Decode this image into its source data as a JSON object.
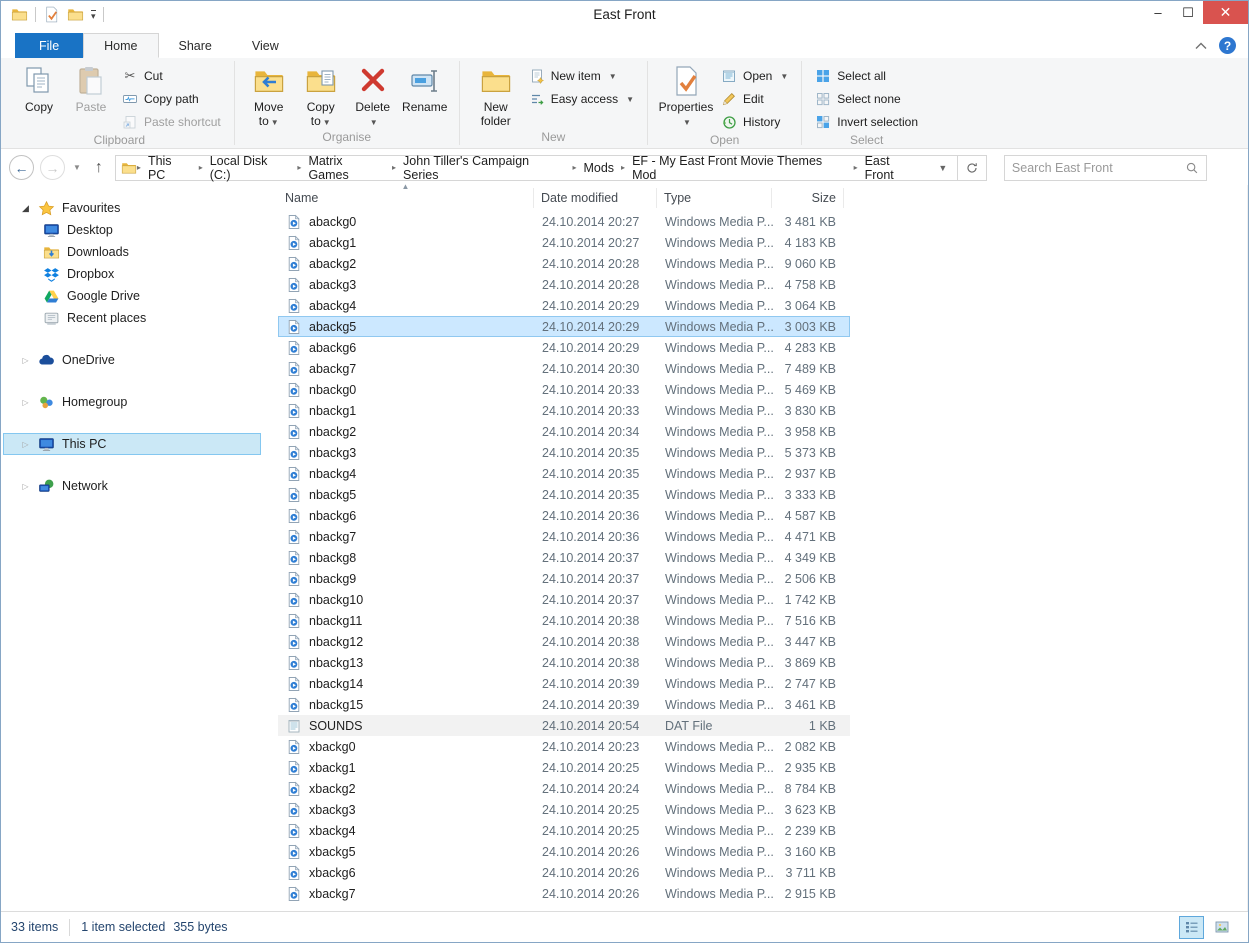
{
  "window": {
    "title": "East Front"
  },
  "colors": {
    "accent_blue": "#1973c5",
    "selection_bg": "#cce8ff",
    "selection_border": "#90c8f0",
    "sidebar_selection_bg": "#cbe8f6",
    "close_button_red": "#d9534f",
    "status_text": "#24456e",
    "ribbon_bg": "#f5f6f7"
  },
  "tabs": {
    "file": "File",
    "home": "Home",
    "share": "Share",
    "view": "View",
    "active": "Home"
  },
  "ribbon": {
    "clipboard": {
      "label": "Clipboard",
      "copy": "Copy",
      "paste": "Paste",
      "cut": "Cut",
      "copy_path": "Copy path",
      "paste_shortcut": "Paste shortcut"
    },
    "organise": {
      "label": "Organise",
      "move_to": "Move to",
      "copy_to": "Copy to",
      "delete": "Delete",
      "rename": "Rename"
    },
    "new": {
      "label": "New",
      "new_folder": "New folder",
      "new_item": "New item",
      "easy_access": "Easy access"
    },
    "open": {
      "label": "Open",
      "properties": "Properties",
      "open": "Open",
      "edit": "Edit",
      "history": "History"
    },
    "select": {
      "label": "Select",
      "select_all": "Select all",
      "select_none": "Select none",
      "invert_selection": "Invert selection"
    }
  },
  "address": {
    "crumbs": [
      "This PC",
      "Local Disk (C:)",
      "Matrix Games",
      "John Tiller's Campaign Series",
      "Mods",
      "EF - My East Front Movie Themes Mod",
      "East Front"
    ],
    "search_placeholder": "Search East Front"
  },
  "sidebar": {
    "sections": [
      {
        "label": "Favourites",
        "icon": "i-star",
        "expanded": true,
        "children": [
          {
            "label": "Desktop",
            "icon": "i-monitor"
          },
          {
            "label": "Downloads",
            "icon": "i-downloads"
          },
          {
            "label": "Dropbox",
            "icon": "i-dropbox"
          },
          {
            "label": "Google Drive",
            "icon": "i-gdrive"
          },
          {
            "label": "Recent places",
            "icon": "i-recent"
          }
        ]
      },
      {
        "label": "OneDrive",
        "icon": "i-cloud",
        "expanded": false,
        "children": []
      },
      {
        "label": "Homegroup",
        "icon": "i-homegroup",
        "expanded": false,
        "children": []
      },
      {
        "label": "This PC",
        "icon": "i-monitor",
        "expanded": false,
        "selected": true,
        "children": []
      },
      {
        "label": "Network",
        "icon": "i-network",
        "expanded": false,
        "children": []
      }
    ]
  },
  "list": {
    "columns": {
      "name": "Name",
      "date": "Date modified",
      "type": "Type",
      "size": "Size"
    },
    "sort_column": "Name",
    "rows": [
      {
        "name": "abackg0",
        "date": "24.10.2014 20:27",
        "type": "Windows Media P...",
        "size": "3 481 KB",
        "icon": "i-wmp"
      },
      {
        "name": "abackg1",
        "date": "24.10.2014 20:27",
        "type": "Windows Media P...",
        "size": "4 183 KB",
        "icon": "i-wmp"
      },
      {
        "name": "abackg2",
        "date": "24.10.2014 20:28",
        "type": "Windows Media P...",
        "size": "9 060 KB",
        "icon": "i-wmp"
      },
      {
        "name": "abackg3",
        "date": "24.10.2014 20:28",
        "type": "Windows Media P...",
        "size": "4 758 KB",
        "icon": "i-wmp"
      },
      {
        "name": "abackg4",
        "date": "24.10.2014 20:29",
        "type": "Windows Media P...",
        "size": "3 064 KB",
        "icon": "i-wmp"
      },
      {
        "name": "abackg5",
        "date": "24.10.2014 20:29",
        "type": "Windows Media P...",
        "size": "3 003 KB",
        "icon": "i-wmp",
        "selected": true
      },
      {
        "name": "abackg6",
        "date": "24.10.2014 20:29",
        "type": "Windows Media P...",
        "size": "4 283 KB",
        "icon": "i-wmp"
      },
      {
        "name": "abackg7",
        "date": "24.10.2014 20:30",
        "type": "Windows Media P...",
        "size": "7 489 KB",
        "icon": "i-wmp"
      },
      {
        "name": "nbackg0",
        "date": "24.10.2014 20:33",
        "type": "Windows Media P...",
        "size": "5 469 KB",
        "icon": "i-wmp"
      },
      {
        "name": "nbackg1",
        "date": "24.10.2014 20:33",
        "type": "Windows Media P...",
        "size": "3 830 KB",
        "icon": "i-wmp"
      },
      {
        "name": "nbackg2",
        "date": "24.10.2014 20:34",
        "type": "Windows Media P...",
        "size": "3 958 KB",
        "icon": "i-wmp"
      },
      {
        "name": "nbackg3",
        "date": "24.10.2014 20:35",
        "type": "Windows Media P...",
        "size": "5 373 KB",
        "icon": "i-wmp"
      },
      {
        "name": "nbackg4",
        "date": "24.10.2014 20:35",
        "type": "Windows Media P...",
        "size": "2 937 KB",
        "icon": "i-wmp"
      },
      {
        "name": "nbackg5",
        "date": "24.10.2014 20:35",
        "type": "Windows Media P...",
        "size": "3 333 KB",
        "icon": "i-wmp"
      },
      {
        "name": "nbackg6",
        "date": "24.10.2014 20:36",
        "type": "Windows Media P...",
        "size": "4 587 KB",
        "icon": "i-wmp"
      },
      {
        "name": "nbackg7",
        "date": "24.10.2014 20:36",
        "type": "Windows Media P...",
        "size": "4 471 KB",
        "icon": "i-wmp"
      },
      {
        "name": "nbackg8",
        "date": "24.10.2014 20:37",
        "type": "Windows Media P...",
        "size": "4 349 KB",
        "icon": "i-wmp"
      },
      {
        "name": "nbackg9",
        "date": "24.10.2014 20:37",
        "type": "Windows Media P...",
        "size": "2 506 KB",
        "icon": "i-wmp"
      },
      {
        "name": "nbackg10",
        "date": "24.10.2014 20:37",
        "type": "Windows Media P...",
        "size": "1 742 KB",
        "icon": "i-wmp"
      },
      {
        "name": "nbackg11",
        "date": "24.10.2014 20:38",
        "type": "Windows Media P...",
        "size": "7 516 KB",
        "icon": "i-wmp"
      },
      {
        "name": "nbackg12",
        "date": "24.10.2014 20:38",
        "type": "Windows Media P...",
        "size": "3 447 KB",
        "icon": "i-wmp"
      },
      {
        "name": "nbackg13",
        "date": "24.10.2014 20:38",
        "type": "Windows Media P...",
        "size": "3 869 KB",
        "icon": "i-wmp"
      },
      {
        "name": "nbackg14",
        "date": "24.10.2014 20:39",
        "type": "Windows Media P...",
        "size": "2 747 KB",
        "icon": "i-wmp"
      },
      {
        "name": "nbackg15",
        "date": "24.10.2014 20:39",
        "type": "Windows Media P...",
        "size": "3 461 KB",
        "icon": "i-wmp"
      },
      {
        "name": "SOUNDS",
        "date": "24.10.2014 20:54",
        "type": "DAT File",
        "size": "1 KB",
        "icon": "i-dat",
        "hover": true
      },
      {
        "name": "xbackg0",
        "date": "24.10.2014 20:23",
        "type": "Windows Media P...",
        "size": "2 082 KB",
        "icon": "i-wmp"
      },
      {
        "name": "xbackg1",
        "date": "24.10.2014 20:25",
        "type": "Windows Media P...",
        "size": "2 935 KB",
        "icon": "i-wmp"
      },
      {
        "name": "xbackg2",
        "date": "24.10.2014 20:24",
        "type": "Windows Media P...",
        "size": "8 784 KB",
        "icon": "i-wmp"
      },
      {
        "name": "xbackg3",
        "date": "24.10.2014 20:25",
        "type": "Windows Media P...",
        "size": "3 623 KB",
        "icon": "i-wmp"
      },
      {
        "name": "xbackg4",
        "date": "24.10.2014 20:25",
        "type": "Windows Media P...",
        "size": "2 239 KB",
        "icon": "i-wmp"
      },
      {
        "name": "xbackg5",
        "date": "24.10.2014 20:26",
        "type": "Windows Media P...",
        "size": "3 160 KB",
        "icon": "i-wmp"
      },
      {
        "name": "xbackg6",
        "date": "24.10.2014 20:26",
        "type": "Windows Media P...",
        "size": "3 711 KB",
        "icon": "i-wmp"
      },
      {
        "name": "xbackg7",
        "date": "24.10.2014 20:26",
        "type": "Windows Media P...",
        "size": "2 915 KB",
        "icon": "i-wmp"
      }
    ]
  },
  "status": {
    "items": "33 items",
    "selected": "1 item selected",
    "selected_size": "355 bytes"
  }
}
